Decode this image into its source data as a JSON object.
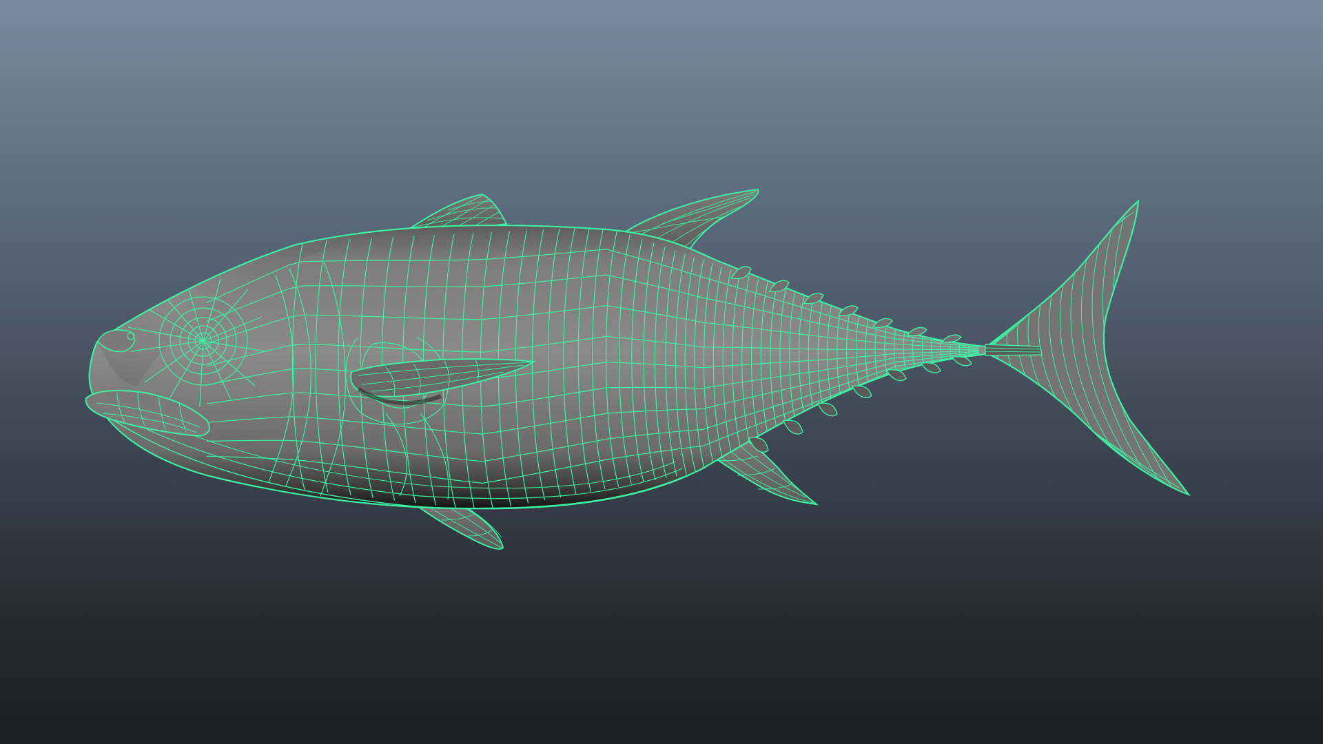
{
  "viewport": {
    "mode": "wireframe-on-shaded",
    "model": "tuna fish mesh",
    "background_top": "#798b9e",
    "background_bottom": "#1c1f22"
  },
  "colors": {
    "wire": "#3cf0a4",
    "surface_light": "#8a8a8a",
    "surface_mid": "#6e6e6e",
    "surface_dark": "#3a3a3a",
    "belly_shadow": "#101010"
  }
}
